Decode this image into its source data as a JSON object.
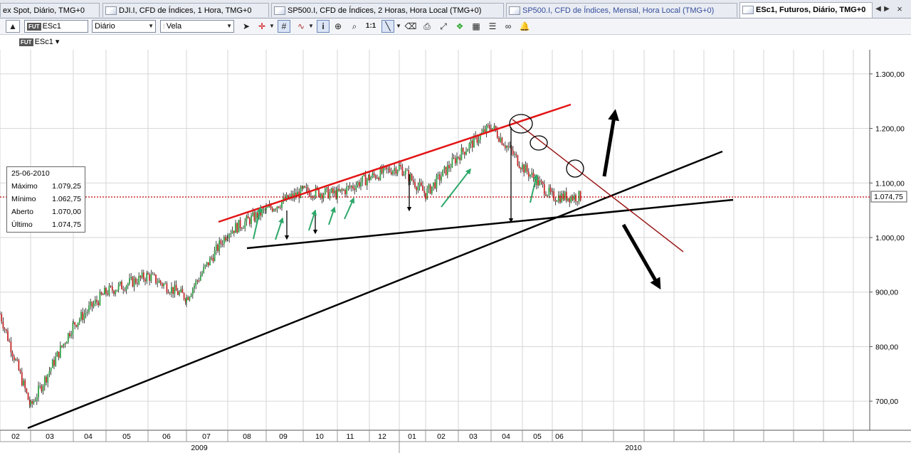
{
  "tabs": [
    {
      "label": "ex Spot, Diário, TMG+0",
      "icon": "chart-tab-icon",
      "close": "×"
    },
    {
      "label": "DJI.I, CFD de Índices, 1 Hora, TMG+0",
      "icon": "chart-tab-icon",
      "close": "×"
    },
    {
      "label": "SP500.I, CFD de Índices, 2 Horas, Hora Local (TMG+0)",
      "icon": "chart-tab-icon",
      "close": "×"
    },
    {
      "label": "SP500.I, CFD de Índices, Mensal, Hora Local (TMG+0)",
      "icon": "chart-tab-icon",
      "close": "×"
    },
    {
      "label": "ESc1, Futuros, Diário, TMG+0",
      "icon": "chart-tab-icon",
      "close": "×",
      "active": true
    }
  ],
  "tab_nav": {
    "prev": "◀",
    "next": "▶"
  },
  "toolbar": {
    "symbol_badge": "FUT",
    "symbol": "ESc1",
    "period": "Diário",
    "chart_style": "Vela",
    "zoom_ratio": "1:1"
  },
  "chart_symbol": {
    "badge": "FUT",
    "label": "ESc1",
    "arrow": "▾"
  },
  "infobox": {
    "date": "25-06-2010",
    "rows": [
      {
        "label": "Máximo",
        "value": "1.079,25"
      },
      {
        "label": "Mínimo",
        "value": "1.062,75"
      },
      {
        "label": "Aberto",
        "value": "1.070,00"
      },
      {
        "label": "Último",
        "value": "1.074,75"
      }
    ]
  },
  "chart_data": {
    "type": "candlestick",
    "ylim": [
      630,
      1330
    ],
    "yticks": [
      {
        "value": 700,
        "label": "700,00"
      },
      {
        "value": 800,
        "label": "800,00"
      },
      {
        "value": 900,
        "label": "900,00"
      },
      {
        "value": 1000,
        "label": "1.000,00"
      },
      {
        "value": 1100,
        "label": "1.100,00"
      },
      {
        "value": 1200,
        "label": "1.200,00"
      },
      {
        "value": 1300,
        "label": "1.300,00"
      }
    ],
    "month_labels": [
      "02",
      "03",
      "04",
      "05",
      "06",
      "07",
      "08",
      "09",
      "10",
      "11",
      "12",
      "01",
      "02",
      "03",
      "04",
      "05",
      "06"
    ],
    "year_labels": [
      "2009",
      "2010"
    ],
    "last_price": {
      "value": 1074.75,
      "label": "1.074,75"
    },
    "price_path": [
      {
        "date": "2009-02",
        "value": 860
      },
      {
        "date": "2009-03",
        "value": 690
      },
      {
        "date": "2009-04",
        "value": 840
      },
      {
        "date": "2009-05",
        "value": 900
      },
      {
        "date": "2009-06",
        "value": 930
      },
      {
        "date": "2009-07",
        "value": 890
      },
      {
        "date": "2009-08",
        "value": 1010
      },
      {
        "date": "2009-09",
        "value": 1050
      },
      {
        "date": "2009-10",
        "value": 1085
      },
      {
        "date": "2009-11",
        "value": 1080
      },
      {
        "date": "2009-12",
        "value": 1110
      },
      {
        "date": "2010-01",
        "value": 1130
      },
      {
        "date": "2010-02",
        "value": 1080
      },
      {
        "date": "2010-03",
        "value": 1150
      },
      {
        "date": "2010-04",
        "value": 1205
      },
      {
        "date": "2010-05",
        "value": 1130
      },
      {
        "date": "2010-06",
        "value": 1075
      }
    ],
    "colors": {
      "up": "#2ea043",
      "down": "#c62828",
      "trend_red": "#e31414",
      "trend_dark": "#9b1c1c",
      "annot_green": "#2ea86a",
      "last_line": "#c00000"
    }
  }
}
